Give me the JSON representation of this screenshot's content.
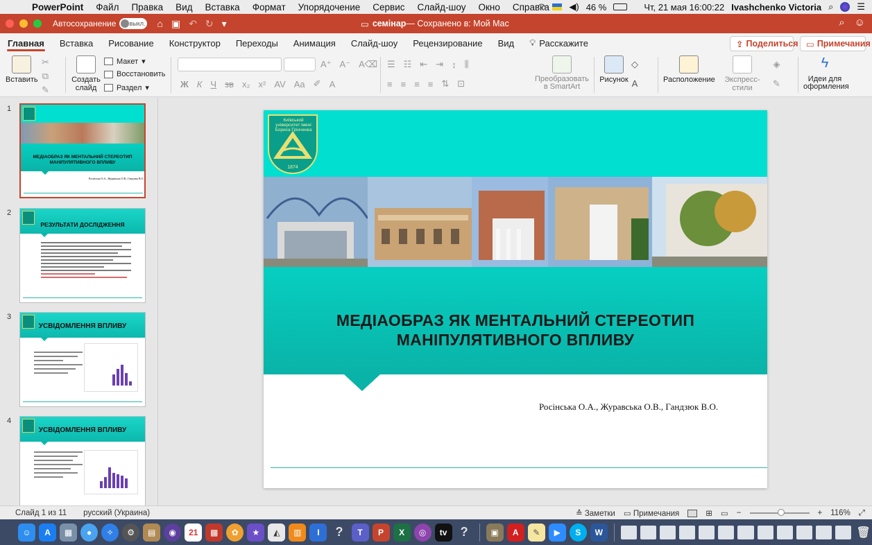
{
  "menubar": {
    "app": "PowerPoint",
    "items": [
      "Файл",
      "Правка",
      "Вид",
      "Вставка",
      "Формат",
      "Упорядочение",
      "Сервис",
      "Слайд-шоу",
      "Окно",
      "Справка"
    ],
    "battery": "46 %",
    "datetime": "Чт, 21 мая  16:00:22",
    "user": "Ivashchenko Victoria"
  },
  "titlebar": {
    "autosave_label": "Автосохранение",
    "autosave_state": "выкл.",
    "doc_name": "семінар",
    "doc_status": " — Сохранено в: Мой Mac"
  },
  "tabs": [
    "Главная",
    "Вставка",
    "Рисование",
    "Конструктор",
    "Переходы",
    "Анимация",
    "Слайд-шоу",
    "Рецензирование",
    "Вид"
  ],
  "tell_me": "Расскажите",
  "share_label": "Поделиться",
  "comments_label": "Примечания",
  "ribbon": {
    "paste": "Вставить",
    "new_slide_l1": "Создать",
    "new_slide_l2": "слайд",
    "layout": "Макет",
    "reset": "Восстановить",
    "section": "Раздел",
    "smartart_l1": "Преобразовать",
    "smartart_l2": "в SmartArt",
    "picture": "Рисунок",
    "arrange": "Расположение",
    "quick_styles": "Экспресс-стили",
    "design_ideas_l1": "Идеи для",
    "design_ideas_l2": "оформления"
  },
  "thumbnails": [
    {
      "num": "1",
      "title": "МЕДІАОБРАЗ ЯК МЕНТАЛЬНИЙ СТЕРЕОТИП МАНІПУЛЯТИВНОГО ВПЛИВУ",
      "authors": "Росінська О.А., Журавська О.В., Гандзюк В.О."
    },
    {
      "num": "2",
      "title": "РЕЗУЛЬТАТИ ДОСЛІДЖЕННЯ"
    },
    {
      "num": "3",
      "title": "УСВІДОМЛЕННЯ ВПЛИВУ"
    },
    {
      "num": "4",
      "title": "УСВІДОМЛЕННЯ ВПЛИВУ"
    }
  ],
  "slide": {
    "logo_text": "Київський університет імені Бориса Грінченка",
    "logo_year": "1874",
    "title_line1": "МЕДІАОБРАЗ ЯК МЕНТАЛЬНИЙ СТЕРЕОТИП",
    "title_line2": "МАНІПУЛЯТИВНОГО ВПЛИВУ",
    "authors": "Росінська О.А., Журавська О.В., Гандзюк В.О."
  },
  "statusbar": {
    "slide_count": "Слайд 1 из 11",
    "language": "русский (Украина)",
    "notes": "Заметки",
    "comments": "Примечания",
    "zoom": "116%"
  },
  "colors": {
    "accent": "#c5442d",
    "slide_teal": "#00dfd0",
    "slide_band": "#0ab3a7",
    "chart_bar": "#6b3fb3"
  }
}
